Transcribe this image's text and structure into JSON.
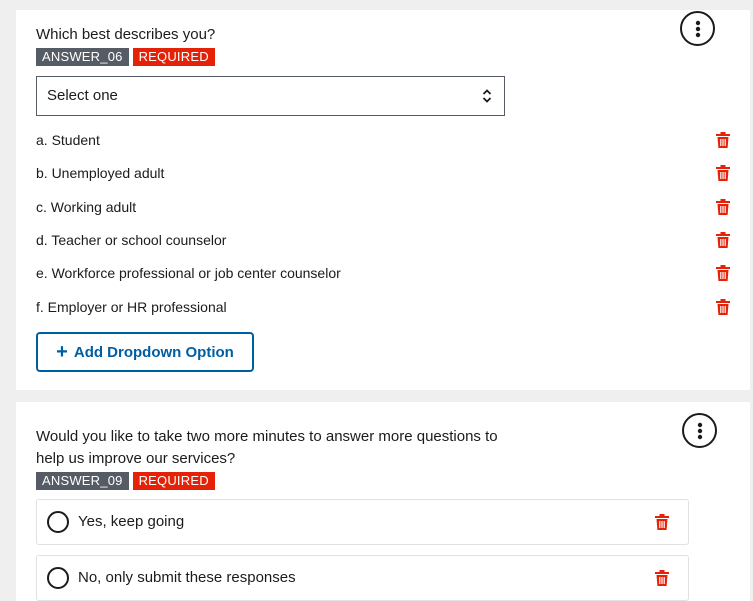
{
  "question1": {
    "text": "Which best describes you?",
    "tag_code": "ANSWER_06",
    "tag_required": "REQUIRED",
    "select_value": "Select one",
    "options": [
      "a. Student",
      "b. Unemployed adult",
      "c. Working adult",
      "d. Teacher or school counselor",
      "e. Workforce professional or job center counselor",
      "f. Employer or HR professional"
    ],
    "add_button_label": "Add Dropdown Option",
    "add_button_icon": "+"
  },
  "question2": {
    "text": "Would you like to take two more minutes to answer more questions to help us improve our services?",
    "tag_code": "ANSWER_09",
    "tag_required": "REQUIRED",
    "radio_options": [
      "Yes, keep going",
      "No, only submit these responses"
    ]
  },
  "icons": {
    "more": "more-vertical-icon",
    "delete": "trash-icon",
    "select": "chevron-up-down-icon"
  },
  "colors": {
    "required_tag": "#e52207",
    "code_tag": "#565c65",
    "primary": "#005ea2",
    "delete": "#e52207"
  }
}
